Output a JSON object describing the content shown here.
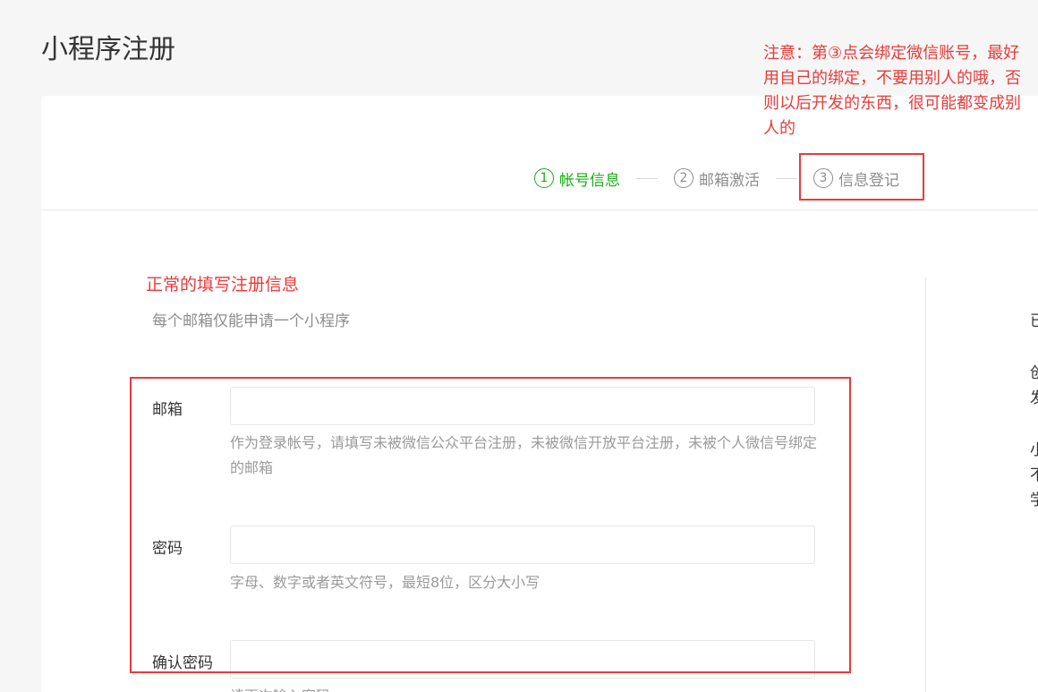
{
  "page": {
    "title": "小程序注册"
  },
  "steps": [
    {
      "num": "1",
      "label": "帐号信息",
      "active": true
    },
    {
      "num": "2",
      "label": "邮箱激活",
      "active": false
    },
    {
      "num": "3",
      "label": "信息登记",
      "active": false
    }
  ],
  "annotation": {
    "note": "注意：第③点会绑定微信账号，最好用自己的绑定，不要用别人的哦，否则以后开发的东西，很可能都变成别人的",
    "form_note": "正常的填写注册信息",
    "color": "#e83b3b"
  },
  "form": {
    "subtitle": "每个邮箱仅能申请一个小程序",
    "email": {
      "label": "邮箱",
      "value": "",
      "hint": "作为登录帐号，请填写未被微信公众平台注册，未被微信开放平台注册，未被个人微信号绑定的邮箱"
    },
    "password": {
      "label": "密码",
      "value": "",
      "hint": "字母、数字或者英文符号，最短8位，区分大小写"
    },
    "confirm_password": {
      "label": "确认密码",
      "value": "",
      "hint": "请再次输入密码"
    }
  },
  "side_panel": {
    "lines": [
      "已",
      "创",
      "发",
      "小",
      "不",
      "学"
    ]
  },
  "colors": {
    "accent_green": "#1aad19",
    "annotation_red": "#e83b3b"
  }
}
